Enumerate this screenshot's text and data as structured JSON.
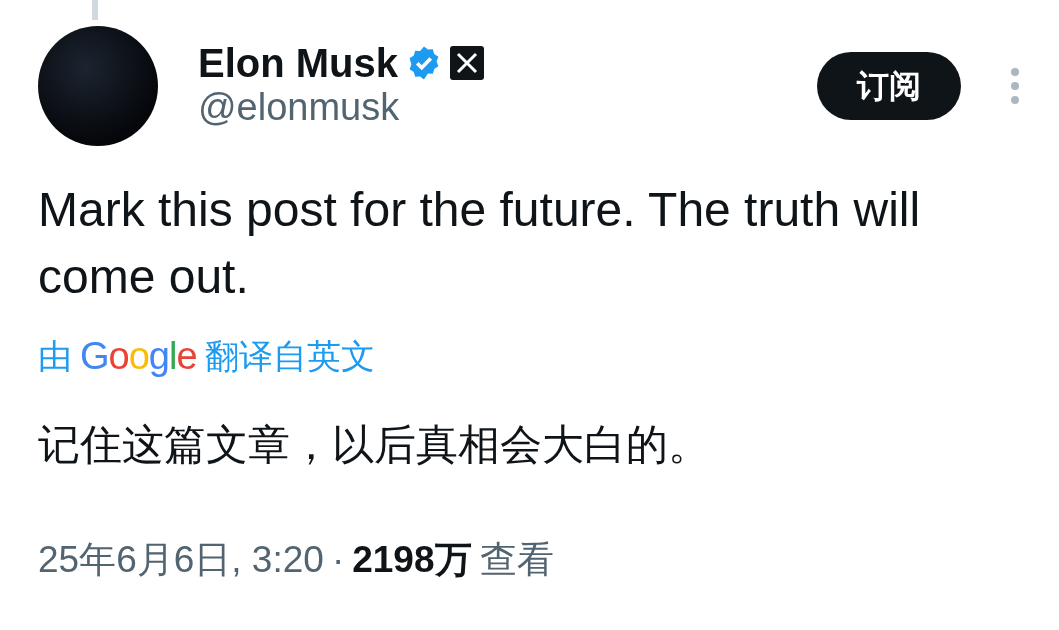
{
  "author": {
    "name": "Elon Musk",
    "verified": true,
    "handle": "@elonmusk"
  },
  "subscribe_button": "订阅",
  "post_text": "Mark this post for the future. The truth will come out.",
  "translation": {
    "prefix": "由",
    "provider": "Google",
    "suffix": "翻译自英文"
  },
  "translated_text": "记住这篇文章，以后真相会大白的。",
  "meta": {
    "date": "25年6月6日, 3:20",
    "separator": "·",
    "views": "2198万",
    "views_label": "查看"
  }
}
